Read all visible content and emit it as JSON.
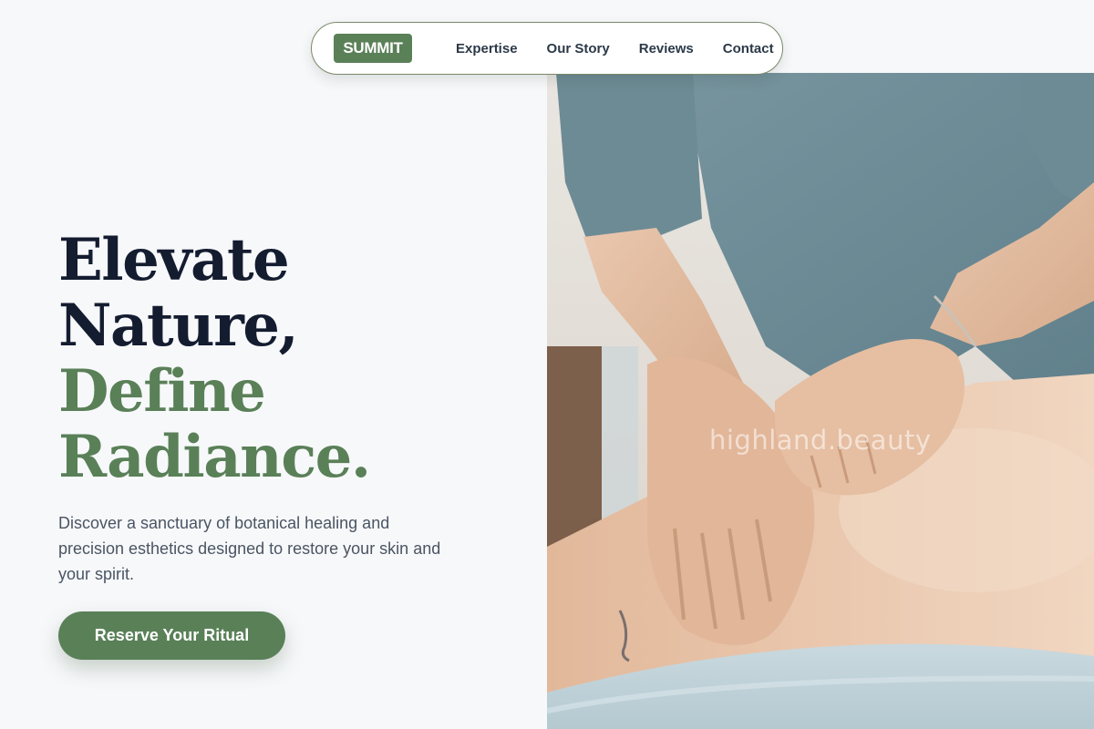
{
  "nav": {
    "logo": "SUMMIT",
    "links": [
      "Expertise",
      "Our Story",
      "Reviews",
      "Contact"
    ]
  },
  "hero": {
    "headline_line1": "Elevate",
    "headline_line2": "Nature,",
    "headline_line3": "Define",
    "headline_line4": "Radiance.",
    "description": "Discover a sanctuary of botanical healing and precision esthetics designed to restore your skin and your spirit.",
    "cta_label": "Reserve Your Ritual",
    "image_watermark": "highland.beauty"
  },
  "colors": {
    "brand_green": "#5a8058",
    "headline_dark": "#141c30",
    "body_text": "#4a5563",
    "background": "#f7f8fa"
  }
}
